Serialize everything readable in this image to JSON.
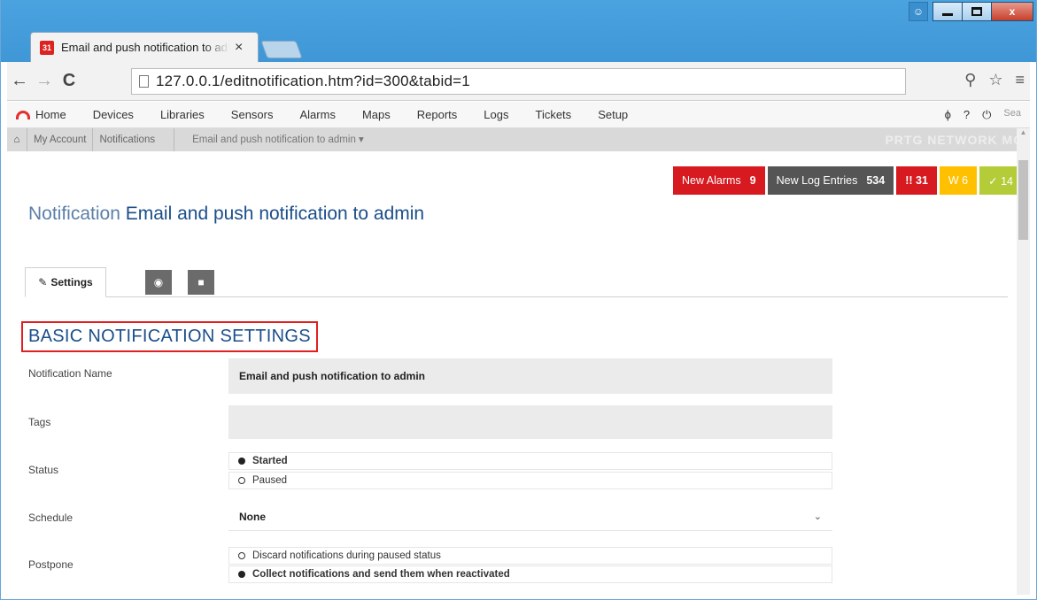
{
  "browser": {
    "tab_title": "Email and push notification to admin",
    "tab_favicon_text": "31",
    "url_host": "127.0.0.1",
    "url_path": "/editnotification.htm?id=300&tabid=1"
  },
  "prtg_nav": {
    "items": [
      "Home",
      "Devices",
      "Libraries",
      "Sensors",
      "Alarms",
      "Maps",
      "Reports",
      "Logs",
      "Tickets",
      "Setup"
    ],
    "search_stub": "Sea"
  },
  "breadcrumb": {
    "items": [
      "My Account",
      "Notifications"
    ],
    "current": "Email and push notification to admin ▾",
    "brand": "PRTG NETWORK MO"
  },
  "alarms": {
    "new_alarms_label": "New Alarms",
    "new_alarms_count": "9",
    "new_log_label": "New Log Entries",
    "new_log_count": "534",
    "red_count": "!! 31",
    "yellow_count": "W 6",
    "green_count": "✓ 14",
    "colors": {
      "red": "#d71920",
      "dark": "#555555",
      "yellow": "#ffc000",
      "green": "#b4cc38"
    }
  },
  "page": {
    "heading_kind": "Notification",
    "heading_name": "Email and push notification to admin",
    "settings_tab": "Settings"
  },
  "section": {
    "title": "BASIC NOTIFICATION SETTINGS"
  },
  "form": {
    "name_label": "Notification Name",
    "name_value": "Email and push notification to admin",
    "tags_label": "Tags",
    "tags_value": "",
    "status_label": "Status",
    "status_options": [
      "Started",
      "Paused"
    ],
    "status_selected": "Started",
    "schedule_label": "Schedule",
    "schedule_value": "None",
    "postpone_label": "Postpone",
    "postpone_options": [
      "Discard notifications during paused status",
      "Collect notifications and send them when reactivated"
    ],
    "postpone_selected": "Collect notifications and send them when reactivated"
  }
}
